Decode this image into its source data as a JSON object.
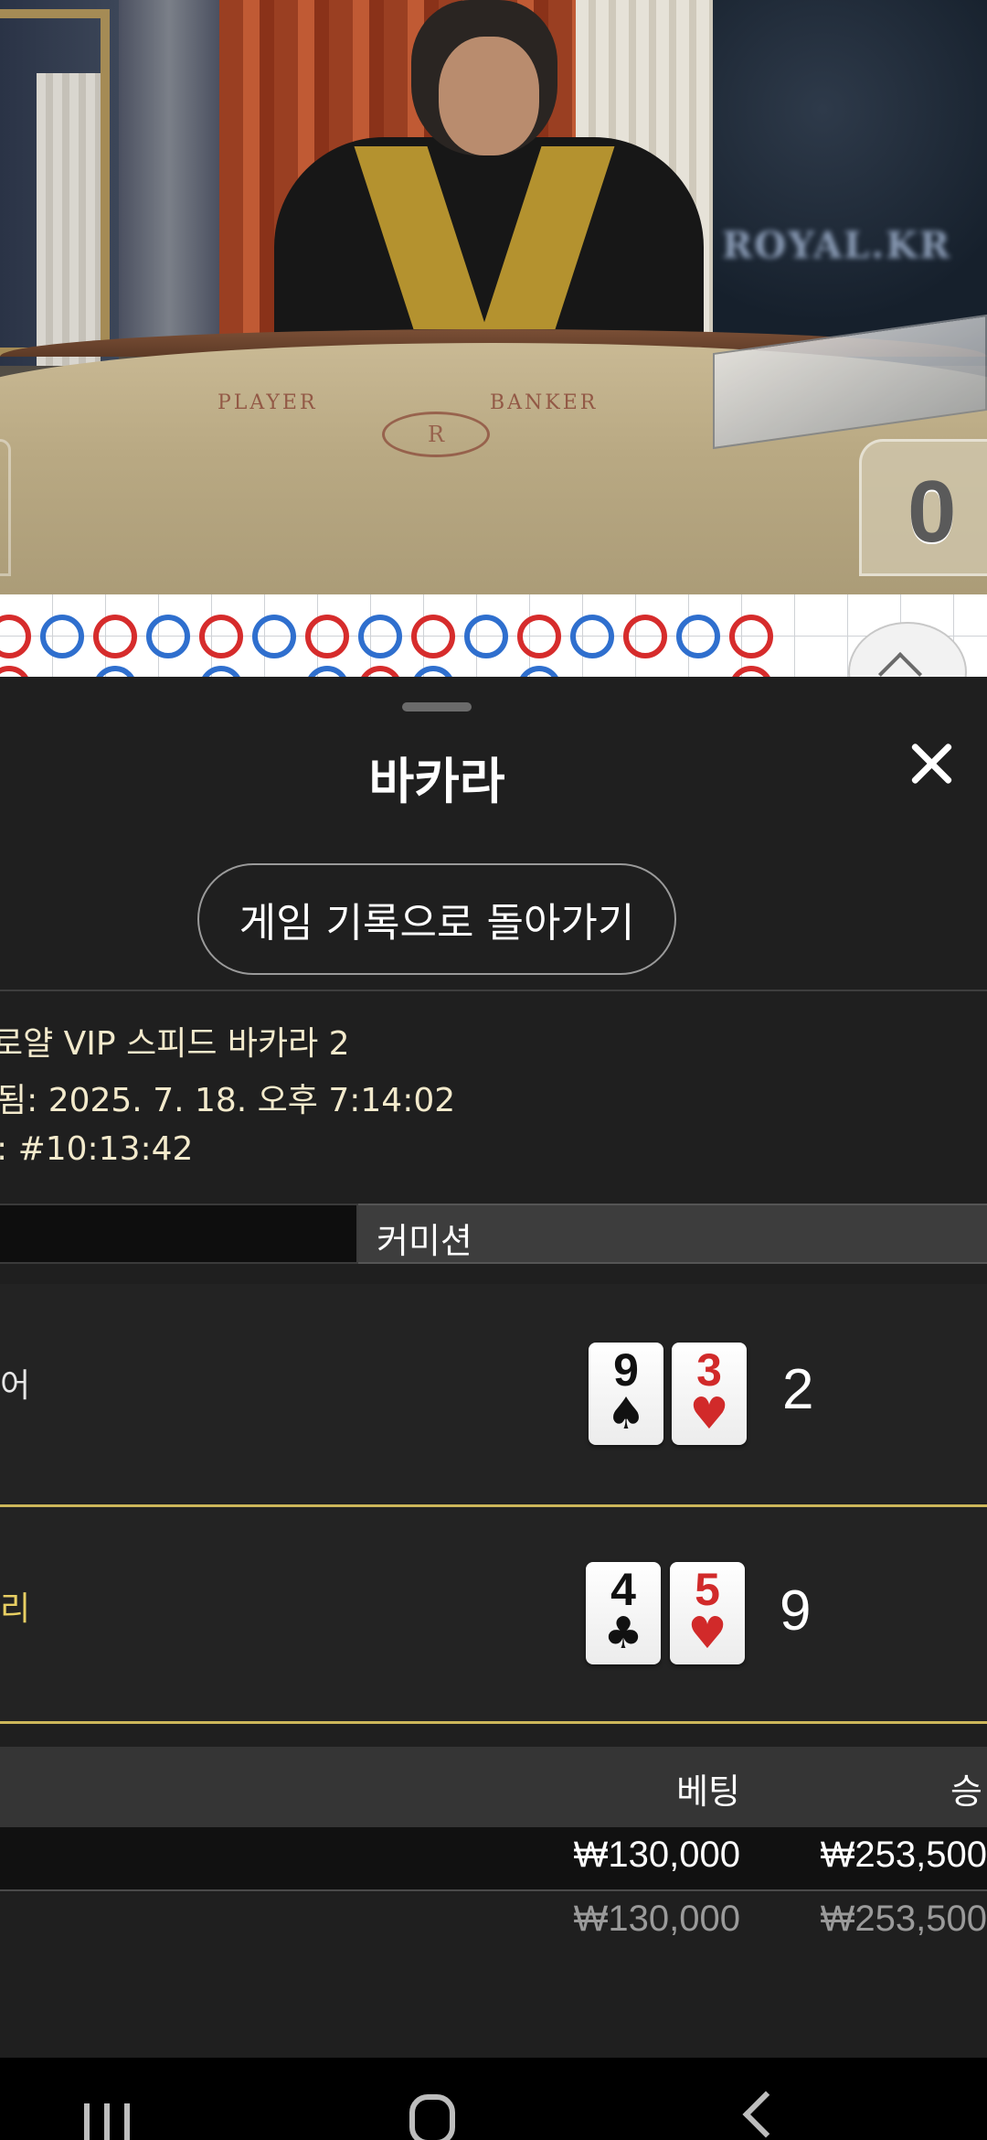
{
  "video": {
    "table_player_text": "PLAYER",
    "table_banker_text": "BANKER",
    "table_emblem_letter": "R",
    "watermark": "ROYAL.KR",
    "live_score": "0"
  },
  "bead_road": {
    "top_row": [
      "red",
      "blue",
      "red",
      "blue",
      "red",
      "blue",
      "red",
      "blue",
      "red",
      "blue",
      "red",
      "blue",
      "red",
      "blue",
      "red"
    ],
    "bottom_row_partial": [
      "red",
      "",
      "blue",
      "",
      "blue",
      "",
      "blue",
      "red",
      "blue",
      "",
      "blue",
      "",
      "",
      "",
      "red"
    ]
  },
  "sheet": {
    "title": "바카라",
    "back_button": "게임 기록으로 돌아가기",
    "info": {
      "table_name": "로얄 VIP 스피드 바카라 2",
      "settled_time": "됨: 2025. 7. 18. 오후 7:14:02",
      "round_id": ": #10:13:42"
    },
    "tabs": {
      "active_left": "",
      "commission": "커미션"
    },
    "hands": [
      {
        "label": "어",
        "cards": [
          {
            "rank": "9",
            "suit": "♠",
            "color": "black"
          },
          {
            "rank": "3",
            "suit": "♥",
            "color": "red"
          }
        ],
        "score": "2",
        "winner": false
      },
      {
        "label": "리",
        "cards": [
          {
            "rank": "4",
            "suit": "♣",
            "color": "black"
          },
          {
            "rank": "5",
            "suit": "♥",
            "color": "red"
          }
        ],
        "score": "9",
        "winner": true
      }
    ],
    "bets": {
      "headers": {
        "bet": "베팅",
        "win": "승"
      },
      "rows": [
        {
          "bet": "₩130,000",
          "win": "₩253,500"
        }
      ],
      "total": {
        "bet": "₩130,000",
        "win": "₩253,500"
      }
    }
  },
  "colors": {
    "accent_gold": "#cdb75a",
    "bead_red": "#d62c2c",
    "bead_blue": "#2f6fce"
  }
}
